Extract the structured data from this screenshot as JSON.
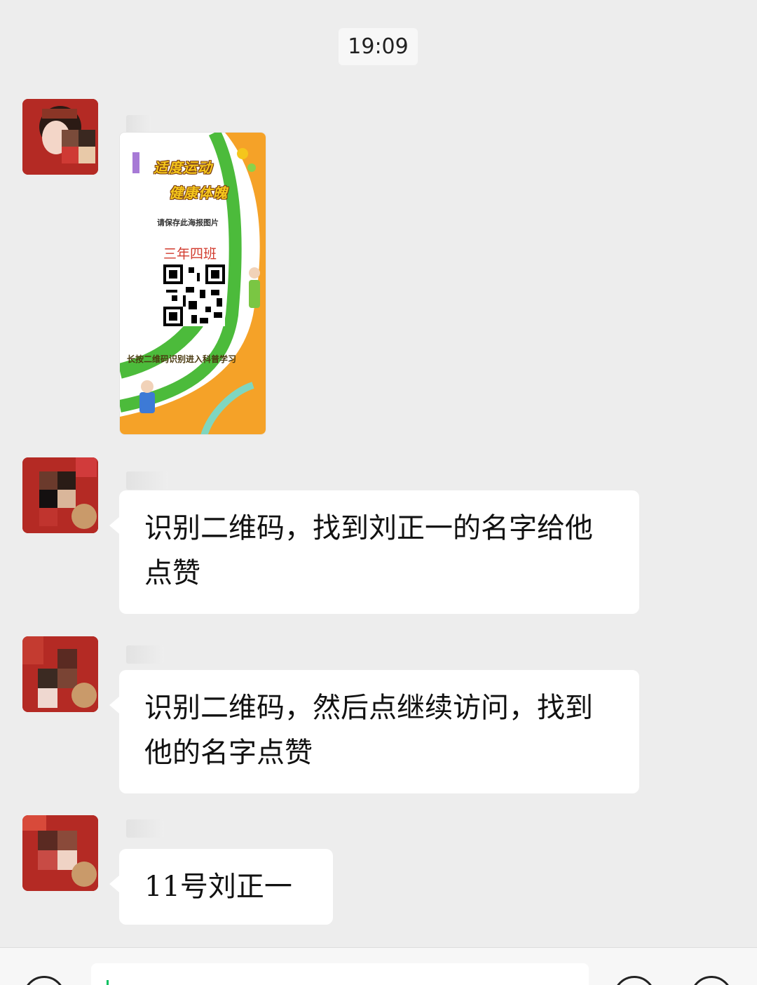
{
  "timestamp": "19:09",
  "poster": {
    "title_line1": "适度运动",
    "title_line2": "健康体魄",
    "save_hint": "请保存此海报图片",
    "class_name": "三年四班",
    "scan_hint": "长按二维码识别进入科普学习",
    "colors": {
      "orange": "#f5a228",
      "green": "#4cbb3b",
      "yellow": "#f5c61c"
    }
  },
  "messages": [
    {
      "type": "image",
      "sender_name": ""
    },
    {
      "type": "text",
      "sender_name": "",
      "text": "识别二维码，找到刘正一的名字给他点赞"
    },
    {
      "type": "text",
      "sender_name": "",
      "text": "识别二维码，然后点继续访问，找到他的名字点赞"
    },
    {
      "type": "text",
      "sender_name": "",
      "text": "11号刘正一"
    }
  ],
  "input_bar": {
    "placeholder": "",
    "icons": [
      "voice-icon",
      "emoji-icon",
      "plus-icon"
    ]
  }
}
